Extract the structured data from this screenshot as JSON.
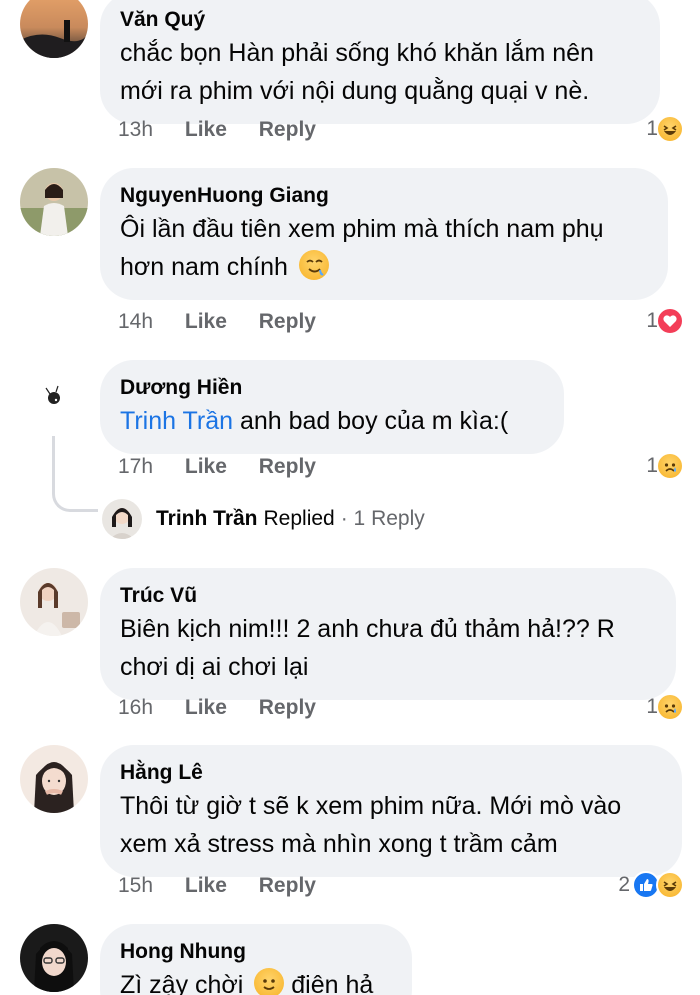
{
  "comments": [
    {
      "author": "Văn Quý",
      "text": "chắc bọn Hàn phải sống khó khăn lắm nên mới ra phim với nội dung quằng quại v nè.",
      "time": "13h",
      "like_label": "Like",
      "reply_label": "Reply",
      "reaction_count": "1",
      "reactions": [
        "haha-emoji-icon"
      ]
    },
    {
      "author": "NguyenHuong Giang",
      "text": "Ôi lần đầu tiên xem phim mà thích nam phụ hơn nam chính",
      "text_emoji": "drooling-face-emoji-icon",
      "time": "14h",
      "like_label": "Like",
      "reply_label": "Reply",
      "reaction_count": "1",
      "reactions": [
        "love-emoji-icon"
      ]
    },
    {
      "author": "Dương Hiền",
      "mention": "Trinh Trần",
      "text": " anh bad boy của m kìa:(",
      "time": "17h",
      "like_label": "Like",
      "reply_label": "Reply",
      "reaction_count": "1",
      "reactions": [
        "sad-emoji-icon"
      ],
      "reply_summary": {
        "name": "Trinh Trần",
        "word": "Replied",
        "count": "· 1 Reply"
      }
    },
    {
      "author": "Trúc Vũ",
      "text": "Biên kịch nim!!! 2 anh chưa đủ thảm hả!?? R chơi dị ai chơi lại",
      "time": "16h",
      "like_label": "Like",
      "reply_label": "Reply",
      "reaction_count": "1",
      "reactions": [
        "sad-emoji-icon"
      ]
    },
    {
      "author": "Hằng Lê",
      "text": "Thôi từ giờ t sẽ k xem phim nữa. Mới mò vào xem xả stress mà nhìn xong t trầm cảm",
      "time": "15h",
      "like_label": "Like",
      "reply_label": "Reply",
      "reaction_count": "2",
      "reactions": [
        "like-emoji-icon",
        "haha-emoji-icon"
      ]
    },
    {
      "author": "Hong Nhung",
      "text": "Zì zậy chời",
      "text_after": " điên hả",
      "text_emoji": "smile-emoji-icon"
    }
  ],
  "colors": {
    "bubble": "#f0f2f5",
    "meta": "#65676b",
    "mention": "#1b74e4",
    "love": "#f33e58",
    "like": "#1877f2",
    "emoji": "#f7b125"
  }
}
